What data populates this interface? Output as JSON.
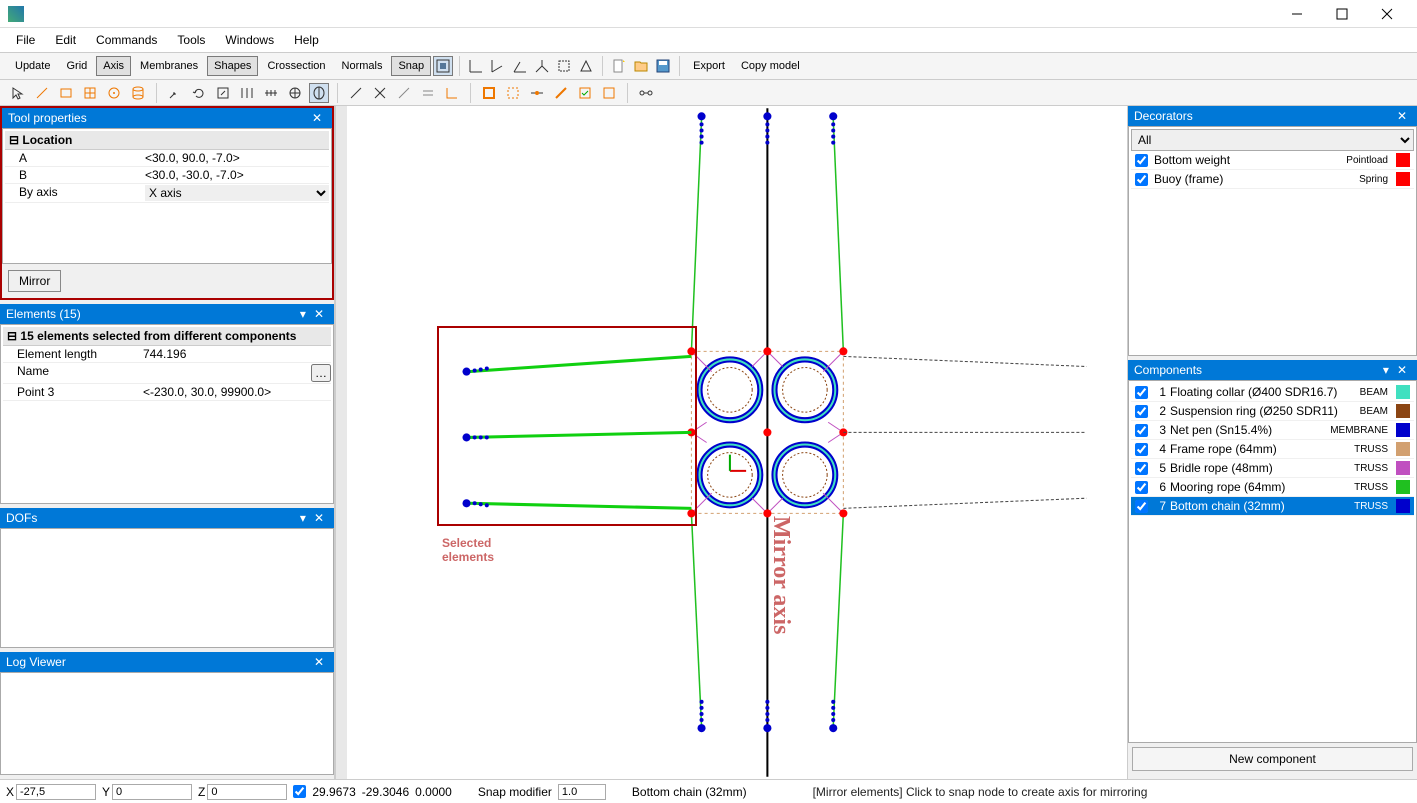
{
  "titlebar": {
    "title": ""
  },
  "menu": [
    "File",
    "Edit",
    "Commands",
    "Tools",
    "Windows",
    "Help"
  ],
  "toolbar1": {
    "buttons": [
      {
        "label": "Update",
        "active": false
      },
      {
        "label": "Grid",
        "active": false
      },
      {
        "label": "Axis",
        "active": true
      },
      {
        "label": "Membranes",
        "active": false
      },
      {
        "label": "Shapes",
        "active": true
      },
      {
        "label": "Crossection",
        "active": false
      },
      {
        "label": "Normals",
        "active": false
      },
      {
        "label": "Snap",
        "active": true
      }
    ],
    "export": "Export",
    "copy": "Copy model"
  },
  "tool_props": {
    "title": "Tool properties",
    "group": "Location",
    "rows": [
      {
        "k": "A",
        "v": "<30.0, 90.0, -7.0>"
      },
      {
        "k": "B",
        "v": "<30.0, -30.0, -7.0>"
      },
      {
        "k": "By axis",
        "v": "X axis"
      }
    ],
    "action": "Mirror"
  },
  "elements": {
    "title": "Elements (15)",
    "header": "15 elements selected from different components",
    "rows": [
      {
        "k": "Element length",
        "v": "744.196"
      },
      {
        "k": "Name",
        "v": ""
      },
      {
        "k": "Point 3",
        "v": "<-230.0, 30.0, 99900.0>"
      }
    ]
  },
  "dofs": {
    "title": "DOFs"
  },
  "log": {
    "title": "Log Viewer"
  },
  "decorators": {
    "title": "Decorators",
    "filter": "All",
    "items": [
      {
        "name": "Bottom weight",
        "tag": "Pointload",
        "color": "#ff0000",
        "checked": true
      },
      {
        "name": "Buoy (frame)",
        "tag": "Spring",
        "color": "#ff0000",
        "checked": true
      }
    ]
  },
  "components": {
    "title": "Components",
    "items": [
      {
        "n": 1,
        "name": "Floating collar (Ø400 SDR16.7)",
        "tag": "BEAM",
        "color": "#40e0c0",
        "checked": true,
        "sel": false
      },
      {
        "n": 2,
        "name": "Suspension ring (Ø250 SDR11)",
        "tag": "BEAM",
        "color": "#8b4513",
        "checked": true,
        "sel": false
      },
      {
        "n": 3,
        "name": "Net pen (Sn15.4%)",
        "tag": "MEMBRANE",
        "color": "#0000cc",
        "checked": true,
        "sel": false
      },
      {
        "n": 4,
        "name": "Frame rope (64mm)",
        "tag": "TRUSS",
        "color": "#d2a070",
        "checked": true,
        "sel": false
      },
      {
        "n": 5,
        "name": "Bridle rope (48mm)",
        "tag": "TRUSS",
        "color": "#c050c0",
        "checked": true,
        "sel": false
      },
      {
        "n": 6,
        "name": "Mooring rope (64mm)",
        "tag": "TRUSS",
        "color": "#20c020",
        "checked": true,
        "sel": false
      },
      {
        "n": 7,
        "name": "Bottom chain (32mm)",
        "tag": "TRUSS",
        "color": "#0000cc",
        "checked": true,
        "sel": true
      }
    ],
    "new": "New component"
  },
  "status": {
    "X": "-27,5",
    "Y": "0",
    "Z": "0",
    "coords": [
      "29.9673",
      "-29.3046",
      "0.0000"
    ],
    "snap_label": "Snap modifier",
    "snap_val": "1.0",
    "component": "Bottom chain (32mm)",
    "msg": "[Mirror elements] Click to snap node to create axis for mirroring"
  },
  "annotations": {
    "selected": "Selected elements",
    "mirror": "Mirror axis"
  }
}
